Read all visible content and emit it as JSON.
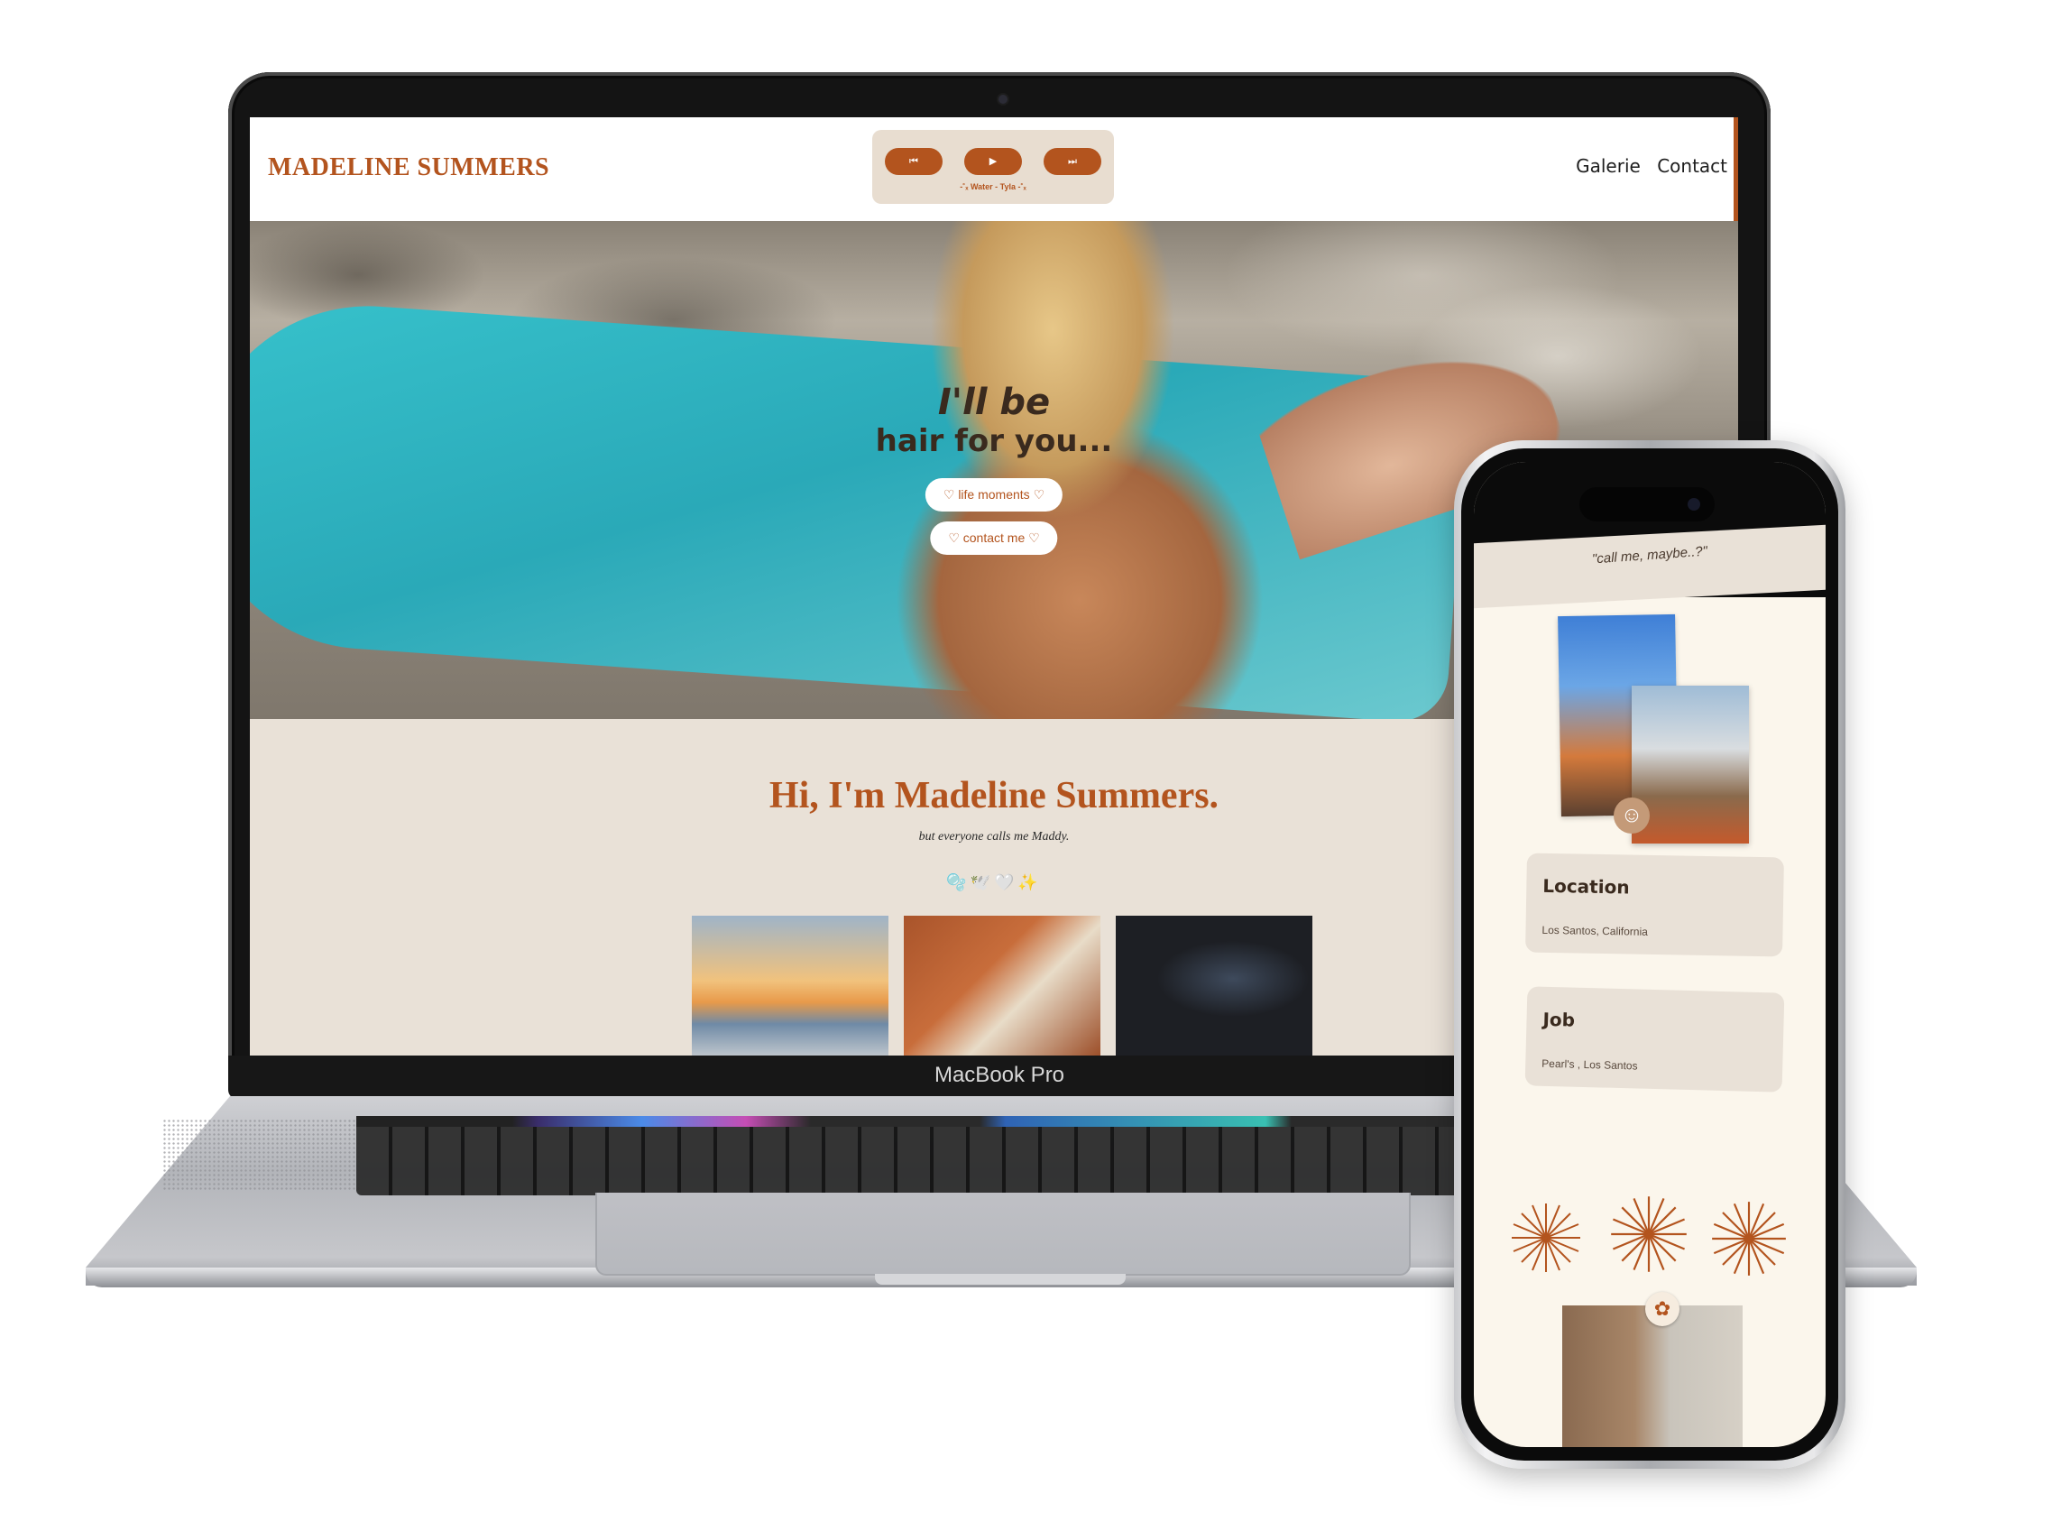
{
  "laptop": {
    "chin_label": "MacBook Pro"
  },
  "site": {
    "logo": "MADELINE SUMMERS",
    "player": {
      "prev_icon": "⏮",
      "play_icon": "▶",
      "next_icon": "⏭",
      "caption": "-˚ₓ Water - Tyla -˚ₓ"
    },
    "nav": [
      "Galerie",
      "Contact"
    ],
    "hero": {
      "title_line1": "I'll be",
      "title_line2": "hair for you...",
      "btn_life": "♡ life moments ♡",
      "btn_contact": "♡ contact me ♡"
    },
    "intro": {
      "title": "Hi, I'm Madeline Summers.",
      "subtitle": "but everyone calls me Maddy.",
      "emojis": "🫧🕊️🤍✨"
    }
  },
  "phone": {
    "quote": "\"call me, maybe..?\"",
    "cards": [
      {
        "title": "Location",
        "value": "Los Santos, California"
      },
      {
        "title": "Job",
        "value": "Pearl's , Los Santos"
      }
    ],
    "smiley_icon": "☺",
    "flower_icon": "✿"
  },
  "colors": {
    "accent": "#b3541e",
    "beige": "#e9e1d7",
    "cream": "#fbf6ec"
  }
}
